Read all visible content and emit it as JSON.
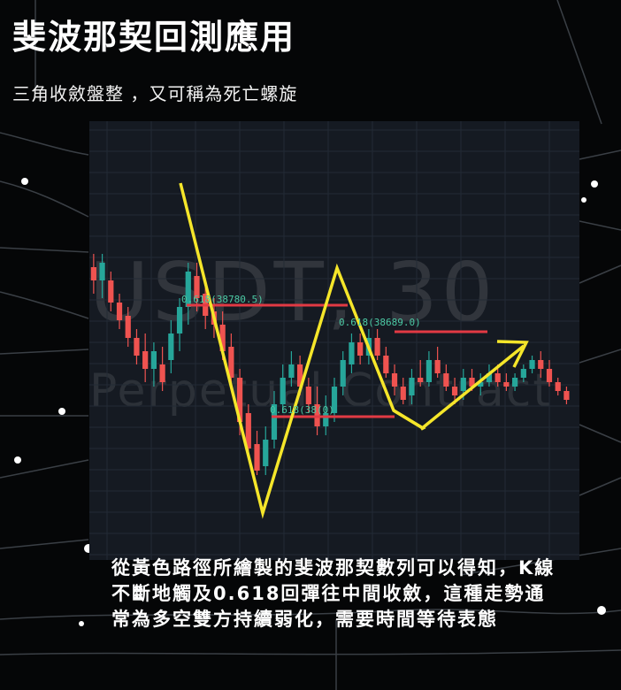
{
  "title": "斐波那契回測應用",
  "subtitle": "三角收斂盤整 ，又可稱為死亡螺旋",
  "chart": {
    "watermark_symbol": "USDT, 30",
    "watermark_sub": "Perpetual Contract",
    "fib_labels": [
      "0.618(38780.5)",
      "0.618(38689.0)",
      "0.618(38(0)"
    ],
    "colors": {
      "panel": "#151a22",
      "up_candle": "#26a69a",
      "down_candle": "#ef5350",
      "path": "#f5e62a",
      "level": "#e23a44"
    }
  },
  "caption": "從黃色路徑所繪製的斐波那契數列可以得知，K線不斷地觸及0.618回彈往中間收斂，這種走勢通常為多空雙方持續弱化，需要時間等待表態"
}
